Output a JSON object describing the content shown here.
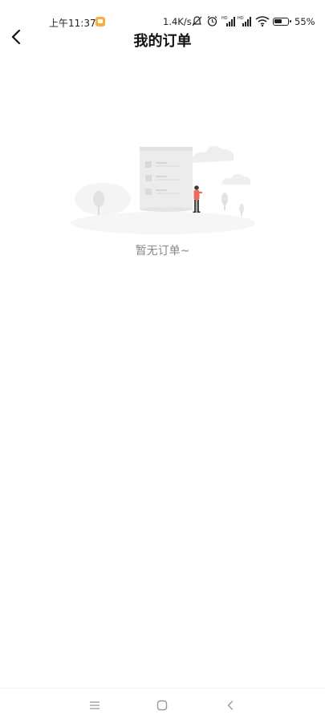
{
  "status_bar": {
    "time": "上午11:37",
    "network_speed": "1.4K/s",
    "battery": "55%",
    "icons": [
      "notification-icon",
      "mute-icon",
      "alarm-icon",
      "signal-hd-icon",
      "signal-hd-icon",
      "wifi-icon",
      "battery-icon"
    ]
  },
  "header": {
    "title": "我的订单",
    "back_icon": "back-arrow-icon"
  },
  "empty_state": {
    "message": "暂无订单~",
    "illustration": "empty-orders-illustration"
  },
  "nav_bar": {
    "buttons": [
      "menu-icon",
      "home-icon",
      "back-icon"
    ]
  },
  "colors": {
    "accent_notification": "#f5b03a",
    "empty_text": "#888888",
    "person_shirt": "#f06a5d"
  }
}
